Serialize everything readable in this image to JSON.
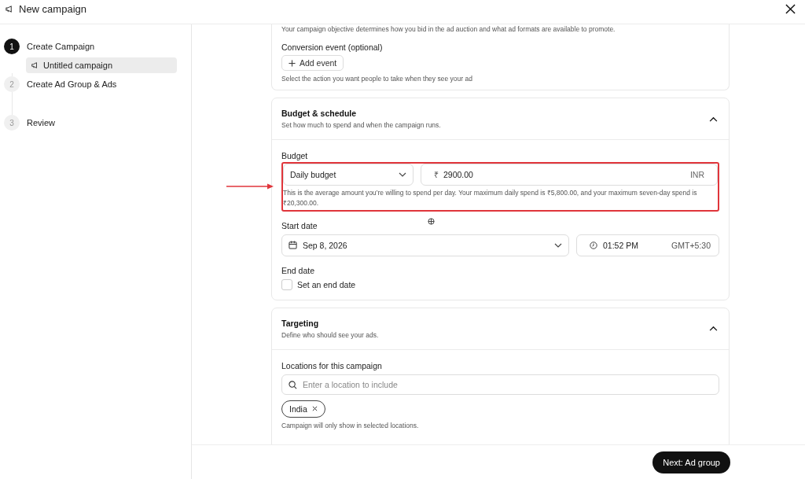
{
  "header": {
    "title": "New campaign"
  },
  "steps": [
    {
      "number": "1",
      "label": "Create Campaign",
      "selected": true,
      "children": [
        {
          "label": "Untitled campaign",
          "selected": true
        }
      ]
    },
    {
      "number": "2",
      "label": "Create Ad Group & Ads",
      "selected": false
    },
    {
      "number": "3",
      "label": "Review",
      "selected": false
    }
  ],
  "objective": {
    "note": "Your campaign objective determines how you bid in the ad auction and what ad formats are available to promote.",
    "conversion_label": "Conversion event (optional)",
    "add_button": "Add event",
    "hint": "Select the action you want people to take when they see your ad"
  },
  "budget": {
    "title": "Budget & schedule",
    "subtitle": "Set how much to spend and when the campaign runs.",
    "expanded": true,
    "label": "Budget",
    "type": "Daily budget",
    "currency_symbol": "₹",
    "amount": "2900.00",
    "currency": "INR",
    "hint": "This is the average amount you’re willing to spend per day. Your maximum daily spend is ₹5,800.00, and your maximum seven-day spend is ₹20,300.00.",
    "start_label": "Start date",
    "start_date": "Sep 8, 2026",
    "start_time": "01:52 PM",
    "timezone": "GMT+5:30",
    "end_label": "End date",
    "end_checkbox": {
      "label": "Set an end date",
      "checked": false
    }
  },
  "targeting": {
    "title": "Targeting",
    "subtitle": "Define who should see your ads.",
    "expanded": true,
    "locations_label": "Locations for this campaign",
    "placeholder": "Enter a location to include",
    "tags": [
      {
        "label": "India"
      }
    ],
    "hint": "Campaign will only show in selected locations."
  },
  "footer": {
    "next_button": "Next: Ad group"
  }
}
